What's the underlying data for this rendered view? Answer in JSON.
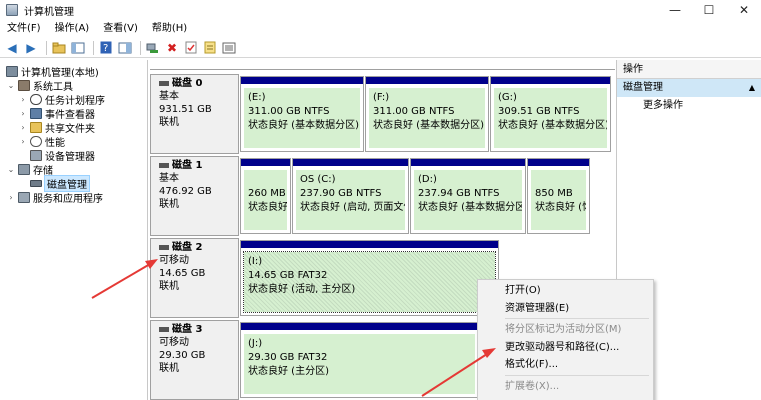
{
  "window": {
    "title": "计算机管理",
    "controls": {
      "minimize": "—",
      "maximize": "☐",
      "close": "✕"
    }
  },
  "menu": [
    "文件(F)",
    "操作(A)",
    "查看(V)",
    "帮助(H)"
  ],
  "toolbar_icons": [
    "back-arrow-icon",
    "forward-arrow-icon",
    "up-folder-icon",
    "show-tree-icon",
    "help-icon",
    "show-pane-icon",
    "connect-icon",
    "delete-icon",
    "properties-icon",
    "refresh-icon",
    "export-list-icon"
  ],
  "tree": [
    {
      "label": "计算机管理(本地)",
      "icon": "computer-icon"
    },
    {
      "label": "系统工具",
      "icon": "tools-icon"
    },
    {
      "label": "任务计划程序",
      "icon": "clock-icon"
    },
    {
      "label": "事件查看器",
      "icon": "event-viewer-icon"
    },
    {
      "label": "共享文件夹",
      "icon": "shared-folder-icon"
    },
    {
      "label": "性能",
      "icon": "performance-icon"
    },
    {
      "label": "设备管理器",
      "icon": "device-manager-icon"
    },
    {
      "label": "存储",
      "icon": "storage-icon"
    },
    {
      "label": "磁盘管理",
      "icon": "disk-management-icon"
    },
    {
      "label": "服务和应用程序",
      "icon": "services-icon"
    }
  ],
  "disks": [
    {
      "name": "磁盘 0",
      "type": "基本",
      "size": "931.51 GB",
      "status": "联机",
      "partitions": [
        {
          "title": "(E:)",
          "line2": "311.00 GB NTFS",
          "line3": "状态良好 (基本数据分区)"
        },
        {
          "title": "(F:)",
          "line2": "311.00 GB NTFS",
          "line3": "状态良好 (基本数据分区)"
        },
        {
          "title": "(G:)",
          "line2": "309.51 GB NTFS",
          "line3": "状态良好 (基本数据分区)"
        }
      ]
    },
    {
      "name": "磁盘 1",
      "type": "基本",
      "size": "476.92 GB",
      "status": "联机",
      "partitions": [
        {
          "title": "",
          "line2": "260 MB",
          "line3": "状态良好"
        },
        {
          "title": "OS  (C:)",
          "line2": "237.90 GB NTFS",
          "line3": "状态良好 (启动, 页面文件,"
        },
        {
          "title": "(D:)",
          "line2": "237.94 GB NTFS",
          "line3": "状态良好 (基本数据分区)"
        },
        {
          "title": "",
          "line2": "850 MB",
          "line3": "状态良好 (恢"
        }
      ]
    },
    {
      "name": "磁盘 2",
      "type": "可移动",
      "size": "14.65 GB",
      "status": "联机",
      "partitions": [
        {
          "title": "(I:)",
          "line2": "14.65 GB FAT32",
          "line3": "状态良好 (活动, 主分区)"
        }
      ]
    },
    {
      "name": "磁盘 3",
      "type": "可移动",
      "size": "29.30 GB",
      "status": "联机",
      "partitions": [
        {
          "title": "(J:)",
          "line2": "29.30 GB FAT32",
          "line3": "状态良好 (主分区)"
        }
      ]
    }
  ],
  "actions": {
    "header": "操作",
    "section": "磁盘管理",
    "section_arrow": "▲",
    "more": "更多操作",
    "more_arrow": "▶"
  },
  "context_menu": [
    {
      "label": "打开(O)",
      "enabled": true
    },
    {
      "label": "资源管理器(E)",
      "enabled": true
    },
    {
      "label": "将分区标记为活动分区(M)",
      "enabled": false
    },
    {
      "label": "更改驱动器号和路径(C)...",
      "enabled": true
    },
    {
      "label": "格式化(F)...",
      "enabled": true
    },
    {
      "label": "扩展卷(X)...",
      "enabled": false
    }
  ],
  "colors": {
    "partition_bar": "#00008b",
    "partition_fill": "#d6f0d0",
    "arrow": "#e53935",
    "selection": "#cce8ff"
  }
}
